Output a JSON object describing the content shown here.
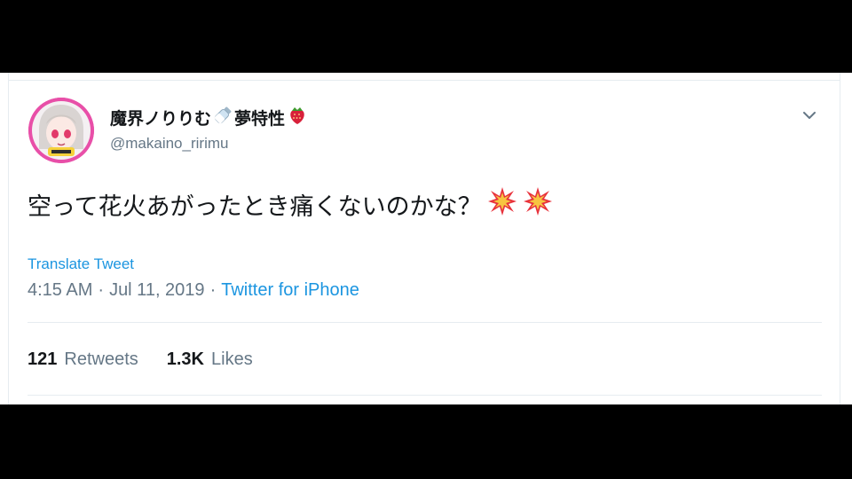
{
  "tweet": {
    "display_name": "魔界ノりりむ",
    "display_name_suffix": "夢特性",
    "handle": "@makaino_ririmu",
    "text": "空って花火あがったとき痛くないのかな？",
    "translate_label": "Translate Tweet",
    "time": "4:15 AM",
    "date": "Jul 11, 2019",
    "separator": "·",
    "source": "Twitter for iPhone",
    "retweets_count": "121",
    "retweets_label": "Retweets",
    "likes_count": "1.3K",
    "likes_label": "Likes"
  },
  "icons": {
    "name_emoji_1": "baby-bottle-icon",
    "name_emoji_2": "strawberry-icon",
    "text_emoji": "collision-icon",
    "menu": "chevron-down-icon"
  },
  "colors": {
    "link": "#1b95e0",
    "text": "#14171a",
    "muted": "#657786",
    "divider": "#e6ecf0"
  }
}
